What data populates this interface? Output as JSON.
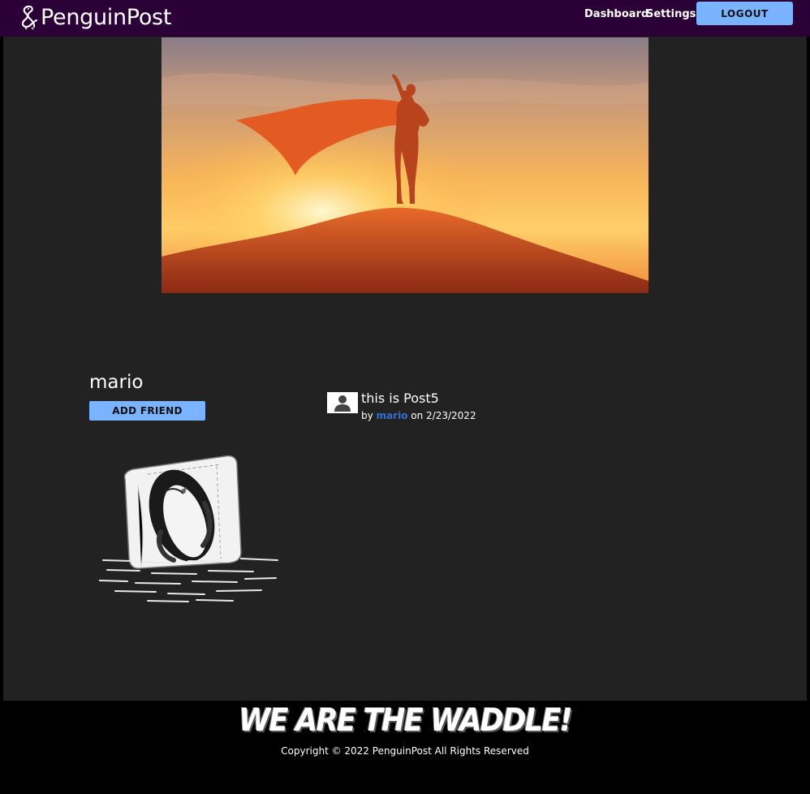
{
  "navbar": {
    "brand": "PenguinPost",
    "links": {
      "dashboard": "Dashboard",
      "settings": "Settings"
    },
    "logout_label": "LOGOUT"
  },
  "profile": {
    "username": "mario",
    "add_friend_label": "ADD FRIEND"
  },
  "posts": [
    {
      "title": "this is Post5",
      "by_prefix": "by",
      "author": "mario",
      "date_prefix": "on",
      "date": "2/23/2022"
    }
  ],
  "footer": {
    "slogan": "WE ARE THE WADDLE!",
    "copyright": "Copyright © 2022 PenguinPost All Rights Reserved"
  },
  "colors": {
    "navbar_bg": "#2b0036",
    "main_bg": "#222222",
    "button_bg": "#7ab3ff",
    "link_color": "#2f6fd6"
  }
}
